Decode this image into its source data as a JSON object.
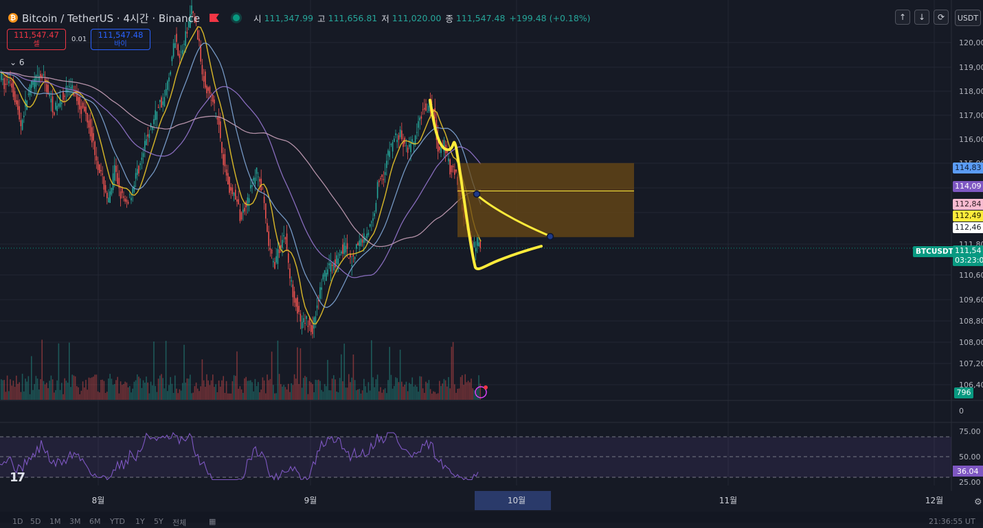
{
  "header": {
    "symbol_title": "Bitcoin / TetherUS · 4시간 · Binance",
    "logo_letter": "₿",
    "ohlc": [
      {
        "label": "시",
        "value": "111,347.99"
      },
      {
        "label": "고",
        "value": "111,656.81"
      },
      {
        "label": "저",
        "value": "111,020.00"
      },
      {
        "label": "종",
        "value": "111,547.48"
      }
    ],
    "change": "+199.48 (+0.18%)"
  },
  "trade": {
    "sell_price": "111,547.47",
    "sell_label": "셀",
    "buy_price": "111,547.48",
    "buy_label": "바이",
    "spread": "0.01"
  },
  "indicator_toggle": "⌄ 6",
  "toolbar": {
    "up": "↑",
    "down": "↓",
    "refresh": "⟳",
    "currency": "USDT"
  },
  "price_axis": {
    "ticks": [
      "120,00",
      "119,00",
      "118,00",
      "117,00",
      "116,00",
      "115,00",
      "111,80",
      "110,60",
      "109,60",
      "108,80",
      "108,00",
      "107,20",
      "106,40"
    ],
    "tags": [
      {
        "text": "114,83",
        "bg": "#5b9cf6",
        "color": "#0c1a2e"
      },
      {
        "text": "114,09",
        "bg": "#7e57c2",
        "color": "#ffffff"
      },
      {
        "text": "112,84",
        "bg": "#f8bbd0",
        "color": "#2a1a20"
      },
      {
        "text": "112,49",
        "bg": "#ffeb3b",
        "color": "#1a1a00"
      },
      {
        "text": "112,46",
        "bg": "#ffffff",
        "color": "#131722"
      },
      {
        "text": "111,54",
        "bg": "#089981",
        "color": "#ffffff"
      },
      {
        "text": "03:23:0",
        "bg": "#089981",
        "color": "#ffffff"
      }
    ],
    "symbol_tag": "BTCUSDT"
  },
  "volume": {
    "badge": "796",
    "zero": "0"
  },
  "rsi": {
    "levels": [
      "75.00",
      "50.00",
      "25.00"
    ],
    "value": "36.04"
  },
  "time_axis": {
    "labels": [
      "8월",
      "9월",
      "10월",
      "11월",
      "12월"
    ],
    "highlight": "10월"
  },
  "bottom_bar": {
    "items": [
      "1D",
      "5D",
      "1M",
      "3M",
      "6M",
      "YTD",
      "1Y",
      "5Y",
      "전체"
    ],
    "clock": "21:36:55 UT"
  },
  "colors": {
    "background": "#161a25",
    "up": "#26a69a",
    "down": "#ef5350",
    "drawing": "#ffeb3b",
    "zone": "#6b4a14",
    "rsi": "#7e57c2"
  },
  "chart_data": {
    "type": "candlestick",
    "title": "Bitcoin / TetherUS · 4시간 · Binance",
    "ylim": [
      106000,
      121000
    ],
    "x_labels": [
      "8월",
      "9월",
      "10월",
      "11월",
      "12월"
    ],
    "close_path_usdt": [
      [
        0,
        118800
      ],
      [
        8,
        118200
      ],
      [
        16,
        118600
      ],
      [
        24,
        117600
      ],
      [
        32,
        116600
      ],
      [
        40,
        117700
      ],
      [
        48,
        118300
      ],
      [
        56,
        118500
      ],
      [
        64,
        118600
      ],
      [
        72,
        117900
      ],
      [
        80,
        117200
      ],
      [
        88,
        117600
      ],
      [
        96,
        118000
      ],
      [
        104,
        118200
      ],
      [
        112,
        117800
      ],
      [
        120,
        117300
      ],
      [
        128,
        117000
      ],
      [
        136,
        116000
      ],
      [
        144,
        115000
      ],
      [
        152,
        114200
      ],
      [
        160,
        113400
      ],
      [
        168,
        114800
      ],
      [
        176,
        113900
      ],
      [
        184,
        113300
      ],
      [
        192,
        113800
      ],
      [
        200,
        114600
      ],
      [
        208,
        115200
      ],
      [
        216,
        116200
      ],
      [
        224,
        116700
      ],
      [
        232,
        117500
      ],
      [
        240,
        117600
      ],
      [
        248,
        118700
      ],
      [
        256,
        120200
      ],
      [
        264,
        119400
      ],
      [
        272,
        120300
      ],
      [
        280,
        121400
      ],
      [
        288,
        120600
      ],
      [
        296,
        118800
      ],
      [
        304,
        118000
      ],
      [
        312,
        117500
      ],
      [
        320,
        116600
      ],
      [
        328,
        114900
      ],
      [
        336,
        113900
      ],
      [
        344,
        113700
      ],
      [
        352,
        112700
      ],
      [
        360,
        113500
      ],
      [
        368,
        114100
      ],
      [
        376,
        114800
      ],
      [
        384,
        113700
      ],
      [
        392,
        111700
      ],
      [
        400,
        110800
      ],
      [
        408,
        111500
      ],
      [
        416,
        112200
      ],
      [
        424,
        110200
      ],
      [
        432,
        109300
      ],
      [
        440,
        108300
      ],
      [
        448,
        108600
      ],
      [
        456,
        108100
      ],
      [
        464,
        109400
      ],
      [
        472,
        110300
      ],
      [
        480,
        110800
      ],
      [
        488,
        110900
      ],
      [
        496,
        111400
      ],
      [
        504,
        111600
      ],
      [
        512,
        110900
      ],
      [
        520,
        111600
      ],
      [
        528,
        111900
      ],
      [
        536,
        112200
      ],
      [
        544,
        112600
      ],
      [
        552,
        114300
      ],
      [
        560,
        114600
      ],
      [
        568,
        115600
      ],
      [
        576,
        116100
      ],
      [
        584,
        116200
      ],
      [
        592,
        115600
      ],
      [
        600,
        115700
      ],
      [
        608,
        116300
      ],
      [
        616,
        117200
      ],
      [
        624,
        117400
      ],
      [
        632,
        117300
      ],
      [
        640,
        115300
      ],
      [
        648,
        115900
      ],
      [
        656,
        114800
      ],
      [
        664,
        114800
      ],
      [
        672,
        113400
      ],
      [
        680,
        112600
      ],
      [
        688,
        111400
      ],
      [
        696,
        111800
      ],
      [
        700,
        111550
      ]
    ],
    "drawings": {
      "zone": {
        "x0": 666,
        "x1": 923,
        "y_top": 115050,
        "y_bottom": 112000
      },
      "zone_midline": 113900
    }
  }
}
